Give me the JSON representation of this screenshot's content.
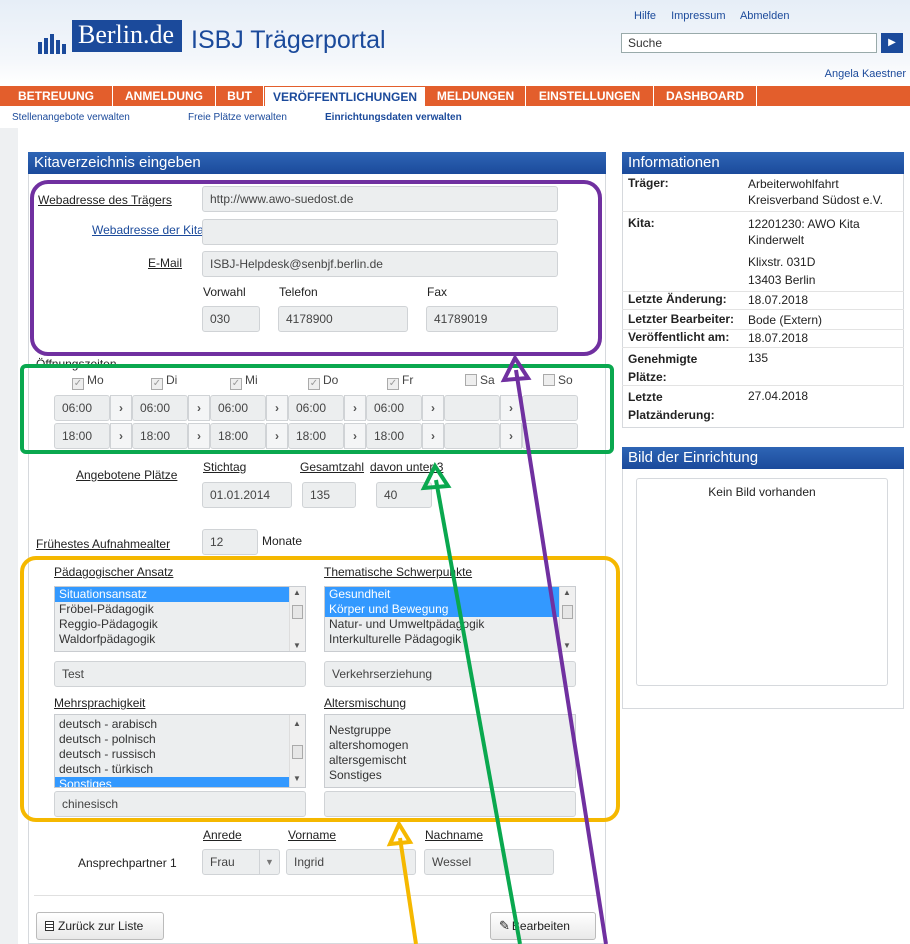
{
  "header": {
    "logo_text": "Berlin.de",
    "portal_title": "ISBJ Trägerportal",
    "links": [
      "Hilfe",
      "Impressum",
      "Abmelden"
    ],
    "search_placeholder": "Suche",
    "user": "Angela Kaestner"
  },
  "nav": {
    "tabs": [
      "BETREUUNG",
      "ANMELDUNG",
      "BUT",
      "VERÖFFENTLICHUNGEN",
      "MELDUNGEN",
      "EINSTELLUNGEN",
      "DASHBOARD"
    ],
    "active": "VERÖFFENTLICHUNGEN",
    "sub": [
      "Stellenangebote verwalten",
      "Freie Plätze verwalten",
      "Einrichtungsdaten verwalten"
    ]
  },
  "form": {
    "title": "Kitaverzeichnis eingeben",
    "web_traeger_label": "Webadresse des Trägers",
    "web_traeger_value": "http://www.awo-suedost.de",
    "web_kita_label": "Webadresse der Kita",
    "web_kita_value": "",
    "email_label": "E-Mail",
    "email_value": "ISBJ-Helpdesk@senbjf.berlin.de",
    "vorwahl_label": "Vorwahl",
    "telefon_label": "Telefon",
    "fax_label": "Fax",
    "vorwahl": "030",
    "telefon": "4178900",
    "fax": "41789019",
    "oeffnungszeiten_label": "Öffnungszeiten",
    "days": [
      {
        "name": "Mo",
        "checked": true,
        "from": "06:00",
        "to": "18:00"
      },
      {
        "name": "Di",
        "checked": true,
        "from": "06:00",
        "to": "18:00"
      },
      {
        "name": "Mi",
        "checked": true,
        "from": "06:00",
        "to": "18:00"
      },
      {
        "name": "Do",
        "checked": true,
        "from": "06:00",
        "to": "18:00"
      },
      {
        "name": "Fr",
        "checked": true,
        "from": "06:00",
        "to": "18:00"
      },
      {
        "name": "Sa",
        "checked": false,
        "from": "",
        "to": ""
      },
      {
        "name": "So",
        "checked": false,
        "from": "",
        "to": ""
      }
    ],
    "plaetze_label": "Angebotene Plätze",
    "stichtag_label": "Stichtag",
    "gesamt_label": "Gesamtzahl",
    "unter3_label": "davon unter 3",
    "stichtag": "01.01.2014",
    "gesamt": "135",
    "unter3": "40",
    "alter_label": "Frühestes Aufnahmealter",
    "alter_value": "12",
    "alter_unit": "Monate",
    "paed_label": "Pädagogischer Ansatz",
    "paed_items": [
      "Situationsansatz",
      "Fröbel-Pädagogik",
      "Reggio-Pädagogik",
      "Waldorfpädagogik"
    ],
    "paed_other": "Test",
    "thema_label": "Thematische Schwerpunkte",
    "thema_items": [
      "Gesundheit",
      "Körper und Bewegung",
      "Natur- und Umweltpädagogik",
      "Interkulturelle Pädagogik"
    ],
    "thema_other": "Verkehrserziehung",
    "mehr_label": "Mehrsprachigkeit",
    "mehr_items": [
      "deutsch - arabisch",
      "deutsch - polnisch",
      "deutsch - russisch",
      "deutsch - türkisch",
      "Sonstiges"
    ],
    "mehr_other": "chinesisch",
    "alters_label": "Altersmischung",
    "alters_items": [
      "Nestgruppe",
      "altershomogen",
      "altersgemischt",
      "Sonstiges"
    ],
    "alters_other": "",
    "anrede_label": "Anrede",
    "vorname_label": "Vorname",
    "nachname_label": "Nachname",
    "ansprech_label": "Ansprechpartner 1",
    "anrede": "Frau",
    "vorname": "Ingrid",
    "nachname": "Wessel",
    "back_button": "Zurück zur Liste",
    "edit_button": "Bearbeiten"
  },
  "info": {
    "title": "Informationen",
    "traeger_k": "Träger:",
    "traeger_v": "Arbeiterwohlfahrt Kreisverband Südost e.V.",
    "kita_k": "Kita:",
    "kita_v1": "12201230: AWO Kita Kinderwelt",
    "kita_v2": "Klixstr. 031D",
    "kita_v3": "13403 Berlin",
    "aenderung_k": "Letzte Änderung:",
    "aenderung_v": "18.07.2018",
    "bearbeiter_k": "Letzter Bearbeiter:",
    "bearbeiter_v": "Bode (Extern)",
    "veroeff_k": "Veröffentlicht am:",
    "veroeff_v": "18.07.2018",
    "genehm_k": "Genehmigte Plätze:",
    "genehm_v": "135",
    "platz_k": "Letzte Platzänderung:",
    "platz_v": "27.04.2018"
  },
  "bild": {
    "title": "Bild der Einrichtung",
    "empty": "Kein Bild vorhanden"
  },
  "colors": {
    "primary": "#1b4a9b",
    "nav": "#e35e2c",
    "purple": "#7030a0",
    "green": "#0aa84f",
    "yellow": "#f5b800",
    "selected": "#3399ff"
  }
}
